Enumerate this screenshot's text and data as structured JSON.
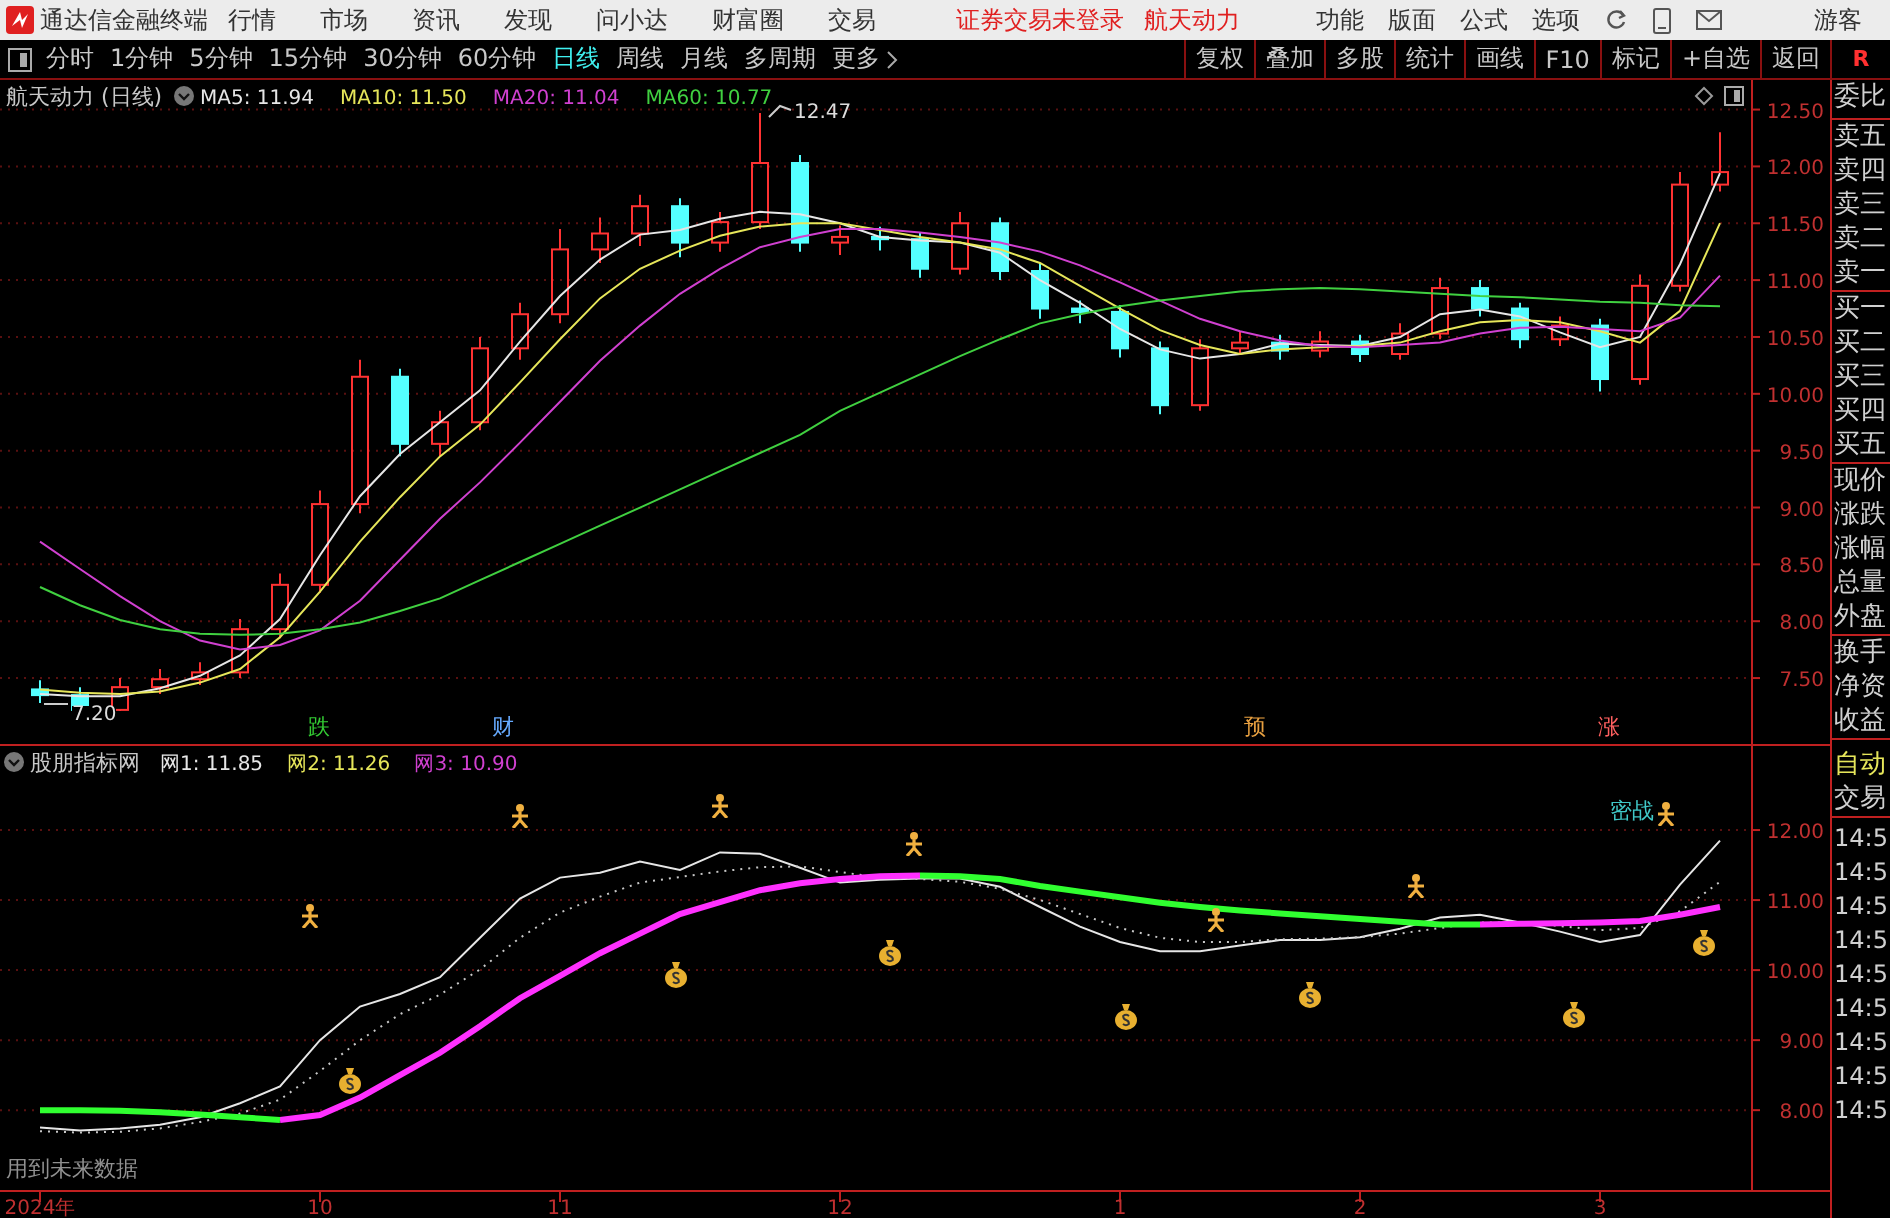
{
  "menu_bar": {
    "app_title": "通达信金融终端",
    "items": [
      "行情",
      "市场",
      "资讯",
      "发现",
      "问小达",
      "财富圈",
      "交易"
    ],
    "login_status": "证券交易未登录",
    "stock_name": "航天动力",
    "right_items": [
      "功能",
      "版面",
      "公式",
      "选项"
    ],
    "user": "游客"
  },
  "period_tabs": [
    {
      "label": "分时",
      "selected": false
    },
    {
      "label": "1分钟",
      "selected": false
    },
    {
      "label": "5分钟",
      "selected": false
    },
    {
      "label": "15分钟",
      "selected": false
    },
    {
      "label": "30分钟",
      "selected": false
    },
    {
      "label": "60分钟",
      "selected": false
    },
    {
      "label": "日线",
      "selected": true
    },
    {
      "label": "周线",
      "selected": false
    },
    {
      "label": "月线",
      "selected": false
    },
    {
      "label": "多周期",
      "selected": false
    },
    {
      "label": "更多",
      "selected": false
    }
  ],
  "tool_buttons": [
    "复权",
    "叠加",
    "多股",
    "统计",
    "画线",
    "F10",
    "标记",
    "+自选",
    "返回"
  ],
  "corner_label": "R",
  "price_chart": {
    "title": "航天动力 (日线)",
    "ma_values": [
      {
        "label": "MA5: 11.94",
        "color": "#e6e6e6"
      },
      {
        "label": "MA10: 11.50",
        "color": "#e6e65a"
      },
      {
        "label": "MA20: 11.04",
        "color": "#d040d0"
      },
      {
        "label": "MA60: 10.77",
        "color": "#40d040"
      }
    ],
    "high_label": "12.47",
    "low_label": "7.20",
    "chart_data": {
      "type": "candlestick",
      "grid": true,
      "ylim": [
        6.92,
        12.76
      ],
      "yticks": [
        {
          "value": 12.5,
          "label": "12.50"
        },
        {
          "value": 12,
          "label": "12.00"
        },
        {
          "value": 11.5,
          "label": "11.50"
        },
        {
          "value": 11,
          "label": "11.00"
        },
        {
          "value": 10.5,
          "label": "10.50"
        },
        {
          "value": 10,
          "label": "10.00"
        },
        {
          "value": 9.5,
          "label": "9.50"
        },
        {
          "value": 9,
          "label": "9.00"
        },
        {
          "value": 8.5,
          "label": "8.50"
        },
        {
          "value": 8,
          "label": "8.00"
        },
        {
          "value": 7.5,
          "label": "7.50"
        }
      ],
      "categories": [
        null,
        null,
        null,
        null,
        null,
        null,
        null,
        null,
        null,
        null,
        null,
        null,
        null,
        null,
        null,
        null,
        null,
        null,
        null,
        null,
        null,
        null,
        null,
        null,
        null,
        null,
        null,
        null,
        null,
        null,
        null,
        null,
        null,
        null,
        null,
        null,
        null,
        null,
        null,
        null,
        null,
        null,
        null
      ],
      "ohlc": [
        [
          7.4,
          7.48,
          7.28,
          7.35
        ],
        [
          7.35,
          7.42,
          7.2,
          7.22
        ],
        [
          7.22,
          7.5,
          7.21,
          7.42
        ],
        [
          7.42,
          7.58,
          7.36,
          7.49
        ],
        [
          7.49,
          7.64,
          7.44,
          7.55
        ],
        [
          7.55,
          8.02,
          7.5,
          7.93
        ],
        [
          7.93,
          8.42,
          7.85,
          8.32
        ],
        [
          8.32,
          9.15,
          8.25,
          9.03
        ],
        [
          9.03,
          10.3,
          8.95,
          10.15
        ],
        [
          10.15,
          10.22,
          9.45,
          9.56
        ],
        [
          9.56,
          9.85,
          9.45,
          9.75
        ],
        [
          9.75,
          10.5,
          9.68,
          10.4
        ],
        [
          10.4,
          10.8,
          10.3,
          10.7
        ],
        [
          10.7,
          11.45,
          10.62,
          11.27
        ],
        [
          11.27,
          11.55,
          11.15,
          11.41
        ],
        [
          11.41,
          11.75,
          11.3,
          11.65
        ],
        [
          11.65,
          11.72,
          11.2,
          11.33
        ],
        [
          11.33,
          11.6,
          11.25,
          11.51
        ],
        [
          11.51,
          12.47,
          11.45,
          12.03
        ],
        [
          12.03,
          12.1,
          11.25,
          11.33
        ],
        [
          11.33,
          11.48,
          11.22,
          11.38
        ],
        [
          11.38,
          11.47,
          11.26,
          11.36
        ],
        [
          11.36,
          11.42,
          11.02,
          11.1
        ],
        [
          11.1,
          11.6,
          11.05,
          11.5
        ],
        [
          11.5,
          11.55,
          11.0,
          11.08
        ],
        [
          11.08,
          11.15,
          10.66,
          10.75
        ],
        [
          10.75,
          10.82,
          10.62,
          10.72
        ],
        [
          10.72,
          10.78,
          10.32,
          10.4
        ],
        [
          10.4,
          10.46,
          9.82,
          9.9
        ],
        [
          9.9,
          10.48,
          9.85,
          10.4
        ],
        [
          10.4,
          10.55,
          10.35,
          10.45
        ],
        [
          10.45,
          10.52,
          10.3,
          10.38
        ],
        [
          10.38,
          10.55,
          10.32,
          10.46
        ],
        [
          10.46,
          10.52,
          10.28,
          10.35
        ],
        [
          10.35,
          10.62,
          10.3,
          10.53
        ],
        [
          10.53,
          11.02,
          10.48,
          10.93
        ],
        [
          10.93,
          11.0,
          10.68,
          10.75
        ],
        [
          10.75,
          10.8,
          10.4,
          10.48
        ],
        [
          10.48,
          10.68,
          10.42,
          10.6
        ],
        [
          10.6,
          10.66,
          10.02,
          10.13
        ],
        [
          10.13,
          11.05,
          10.08,
          10.95
        ],
        [
          10.95,
          11.95,
          10.9,
          11.84
        ],
        [
          11.84,
          12.3,
          11.78,
          11.95
        ]
      ],
      "series": [
        {
          "type": "line",
          "color": "#e6e6e6",
          "values": [
            7.36,
            7.34,
            7.34,
            7.41,
            7.52,
            7.7,
            8.02,
            8.58,
            9.1,
            9.47,
            9.75,
            10.03,
            10.46,
            10.86,
            11.18,
            11.4,
            11.44,
            11.54,
            11.6,
            11.58,
            11.5,
            11.38,
            11.35,
            11.33,
            11.24,
            11.0,
            10.8,
            10.57,
            10.39,
            10.31,
            10.35,
            10.44,
            10.43,
            10.42,
            10.5,
            10.7,
            10.74,
            10.68,
            10.54,
            10.41,
            10.5,
            11.14,
            11.94
          ]
        },
        {
          "type": "line",
          "color": "#e6e65a",
          "values": [
            7.4,
            7.37,
            7.36,
            7.38,
            7.46,
            7.58,
            7.86,
            8.26,
            8.7,
            9.09,
            9.45,
            9.73,
            10.1,
            10.48,
            10.84,
            11.1,
            11.26,
            11.39,
            11.47,
            11.5,
            11.5,
            11.44,
            11.38,
            11.33,
            11.27,
            11.15,
            10.95,
            10.75,
            10.56,
            10.43,
            10.35,
            10.39,
            10.41,
            10.42,
            10.45,
            10.55,
            10.63,
            10.65,
            10.63,
            10.55,
            10.45,
            10.73,
            11.5
          ]
        },
        {
          "type": "line",
          "color": "#d040d0",
          "values": [
            8.7,
            8.46,
            8.22,
            8.0,
            7.83,
            7.75,
            7.79,
            7.92,
            8.18,
            8.54,
            8.9,
            9.22,
            9.57,
            9.93,
            10.29,
            10.6,
            10.88,
            11.1,
            11.29,
            11.38,
            11.45,
            11.45,
            11.42,
            11.38,
            11.33,
            11.25,
            11.13,
            10.98,
            10.82,
            10.66,
            10.55,
            10.47,
            10.42,
            10.41,
            10.43,
            10.45,
            10.53,
            10.58,
            10.59,
            10.57,
            10.55,
            10.67,
            11.04
          ]
        },
        {
          "type": "line",
          "color": "#40d040",
          "values": [
            8.3,
            8.14,
            8.01,
            7.93,
            7.89,
            7.88,
            7.89,
            7.93,
            7.99,
            8.09,
            8.2,
            8.36,
            8.52,
            8.68,
            8.84,
            9.0,
            9.16,
            9.32,
            9.48,
            9.64,
            9.85,
            10.01,
            10.17,
            10.33,
            10.48,
            10.62,
            10.7,
            10.77,
            10.82,
            10.86,
            10.9,
            10.92,
            10.93,
            10.92,
            10.9,
            10.88,
            10.86,
            10.85,
            10.83,
            10.81,
            10.8,
            10.78,
            10.77
          ]
        }
      ]
    },
    "signals": [
      {
        "text": "跌",
        "color": "#33cc33"
      },
      {
        "text": "财",
        "color": "#66aaff"
      },
      {
        "text": "预",
        "color": "#e8a040"
      },
      {
        "text": "涨",
        "color": "#ff6060"
      }
    ]
  },
  "indicator": {
    "title": "股朋指标网",
    "values": [
      {
        "label": "网1: 11.85",
        "color": "#e6e6e6"
      },
      {
        "label": "网2: 11.26",
        "color": "#e6e65a"
      },
      {
        "label": "网3: 10.90",
        "color": "#d040d0"
      }
    ],
    "chart_data": {
      "type": "line",
      "grid": true,
      "ylim": [
        6.86,
        13.2
      ],
      "yticks": [
        {
          "value": 12,
          "label": "12.00"
        },
        {
          "value": 11,
          "label": "11.00"
        },
        {
          "value": 10,
          "label": "10.00"
        },
        {
          "value": 9,
          "label": "9.00"
        },
        {
          "value": 8,
          "label": "8.00"
        }
      ],
      "categories": [
        "2024年",
        null,
        null,
        null,
        null,
        null,
        null,
        "10",
        null,
        null,
        null,
        null,
        null,
        "11",
        null,
        null,
        null,
        null,
        null,
        null,
        "12",
        null,
        null,
        null,
        null,
        null,
        null,
        "1",
        null,
        null,
        null,
        null,
        null,
        "2",
        null,
        null,
        null,
        null,
        null,
        "3",
        null,
        null,
        null
      ],
      "series": [
        {
          "color": "#e6e6e6",
          "line_style": "solid",
          "values": [
            7.75,
            7.71,
            7.74,
            7.79,
            7.9,
            8.1,
            8.34,
            9.0,
            9.48,
            9.66,
            9.9,
            10.46,
            11.02,
            11.32,
            11.39,
            11.55,
            11.43,
            11.68,
            11.66,
            11.46,
            11.25,
            11.29,
            11.31,
            11.31,
            11.19,
            10.9,
            10.62,
            10.4,
            10.27,
            10.27,
            10.35,
            10.43,
            10.43,
            10.47,
            10.59,
            10.75,
            10.79,
            10.68,
            10.55,
            10.4,
            10.5,
            11.22,
            11.85
          ]
        },
        {
          "color": "#c8c8c8",
          "line_style": "dotted",
          "values": [
            7.7,
            7.68,
            7.69,
            7.74,
            7.83,
            7.95,
            8.15,
            8.56,
            9.0,
            9.37,
            9.65,
            10.01,
            10.46,
            10.82,
            11.05,
            11.25,
            11.33,
            11.41,
            11.47,
            11.48,
            11.4,
            11.32,
            11.3,
            11.26,
            11.16,
            11.0,
            10.8,
            10.6,
            10.46,
            10.4,
            10.4,
            10.44,
            10.45,
            10.47,
            10.52,
            10.6,
            10.68,
            10.68,
            10.63,
            10.57,
            10.6,
            10.84,
            11.26
          ]
        },
        {
          "color": "#ff30ff",
          "line_style": "solid",
          "values": [
            null,
            null,
            null,
            null,
            null,
            null,
            7.86,
            7.93,
            8.18,
            8.5,
            8.82,
            9.2,
            9.6,
            9.92,
            10.24,
            10.52,
            10.8,
            10.97,
            11.14,
            11.24,
            11.3,
            11.34,
            11.35,
            null,
            null,
            null,
            null,
            null,
            null,
            null,
            null,
            null,
            null,
            null,
            null,
            null,
            10.65,
            10.66,
            10.67,
            10.68,
            10.7,
            10.79,
            10.9
          ]
        },
        {
          "color": "#30ff30",
          "line_style": "solid",
          "values": [
            8.0,
            8.0,
            7.99,
            7.97,
            7.94,
            7.9,
            7.86,
            null,
            null,
            null,
            null,
            null,
            null,
            null,
            null,
            null,
            null,
            null,
            null,
            null,
            null,
            null,
            11.35,
            11.34,
            11.3,
            11.2,
            11.12,
            11.04,
            10.96,
            10.9,
            10.85,
            10.81,
            10.77,
            10.73,
            10.69,
            10.65,
            10.65,
            null,
            null,
            null,
            null,
            null,
            null
          ]
        }
      ]
    },
    "note": "密战",
    "footnote": "用到未来数据"
  },
  "side_panel": {
    "quote_groups": [
      [
        "委比"
      ],
      [
        "卖五",
        "卖四",
        "卖三",
        "卖二",
        "卖一"
      ],
      [
        "买一",
        "买二",
        "买三",
        "买四",
        "买五"
      ],
      [
        "现价",
        "涨跌",
        "涨幅",
        "总量",
        "外盘"
      ],
      [
        "换手",
        "净资",
        "收益"
      ]
    ],
    "auto_label": "自动",
    "trade_label": "交易",
    "times": [
      "14:5",
      "14:5",
      "14:5",
      "14:5",
      "14:5",
      "14:5",
      "14:5",
      "14:5",
      "14:5"
    ]
  }
}
